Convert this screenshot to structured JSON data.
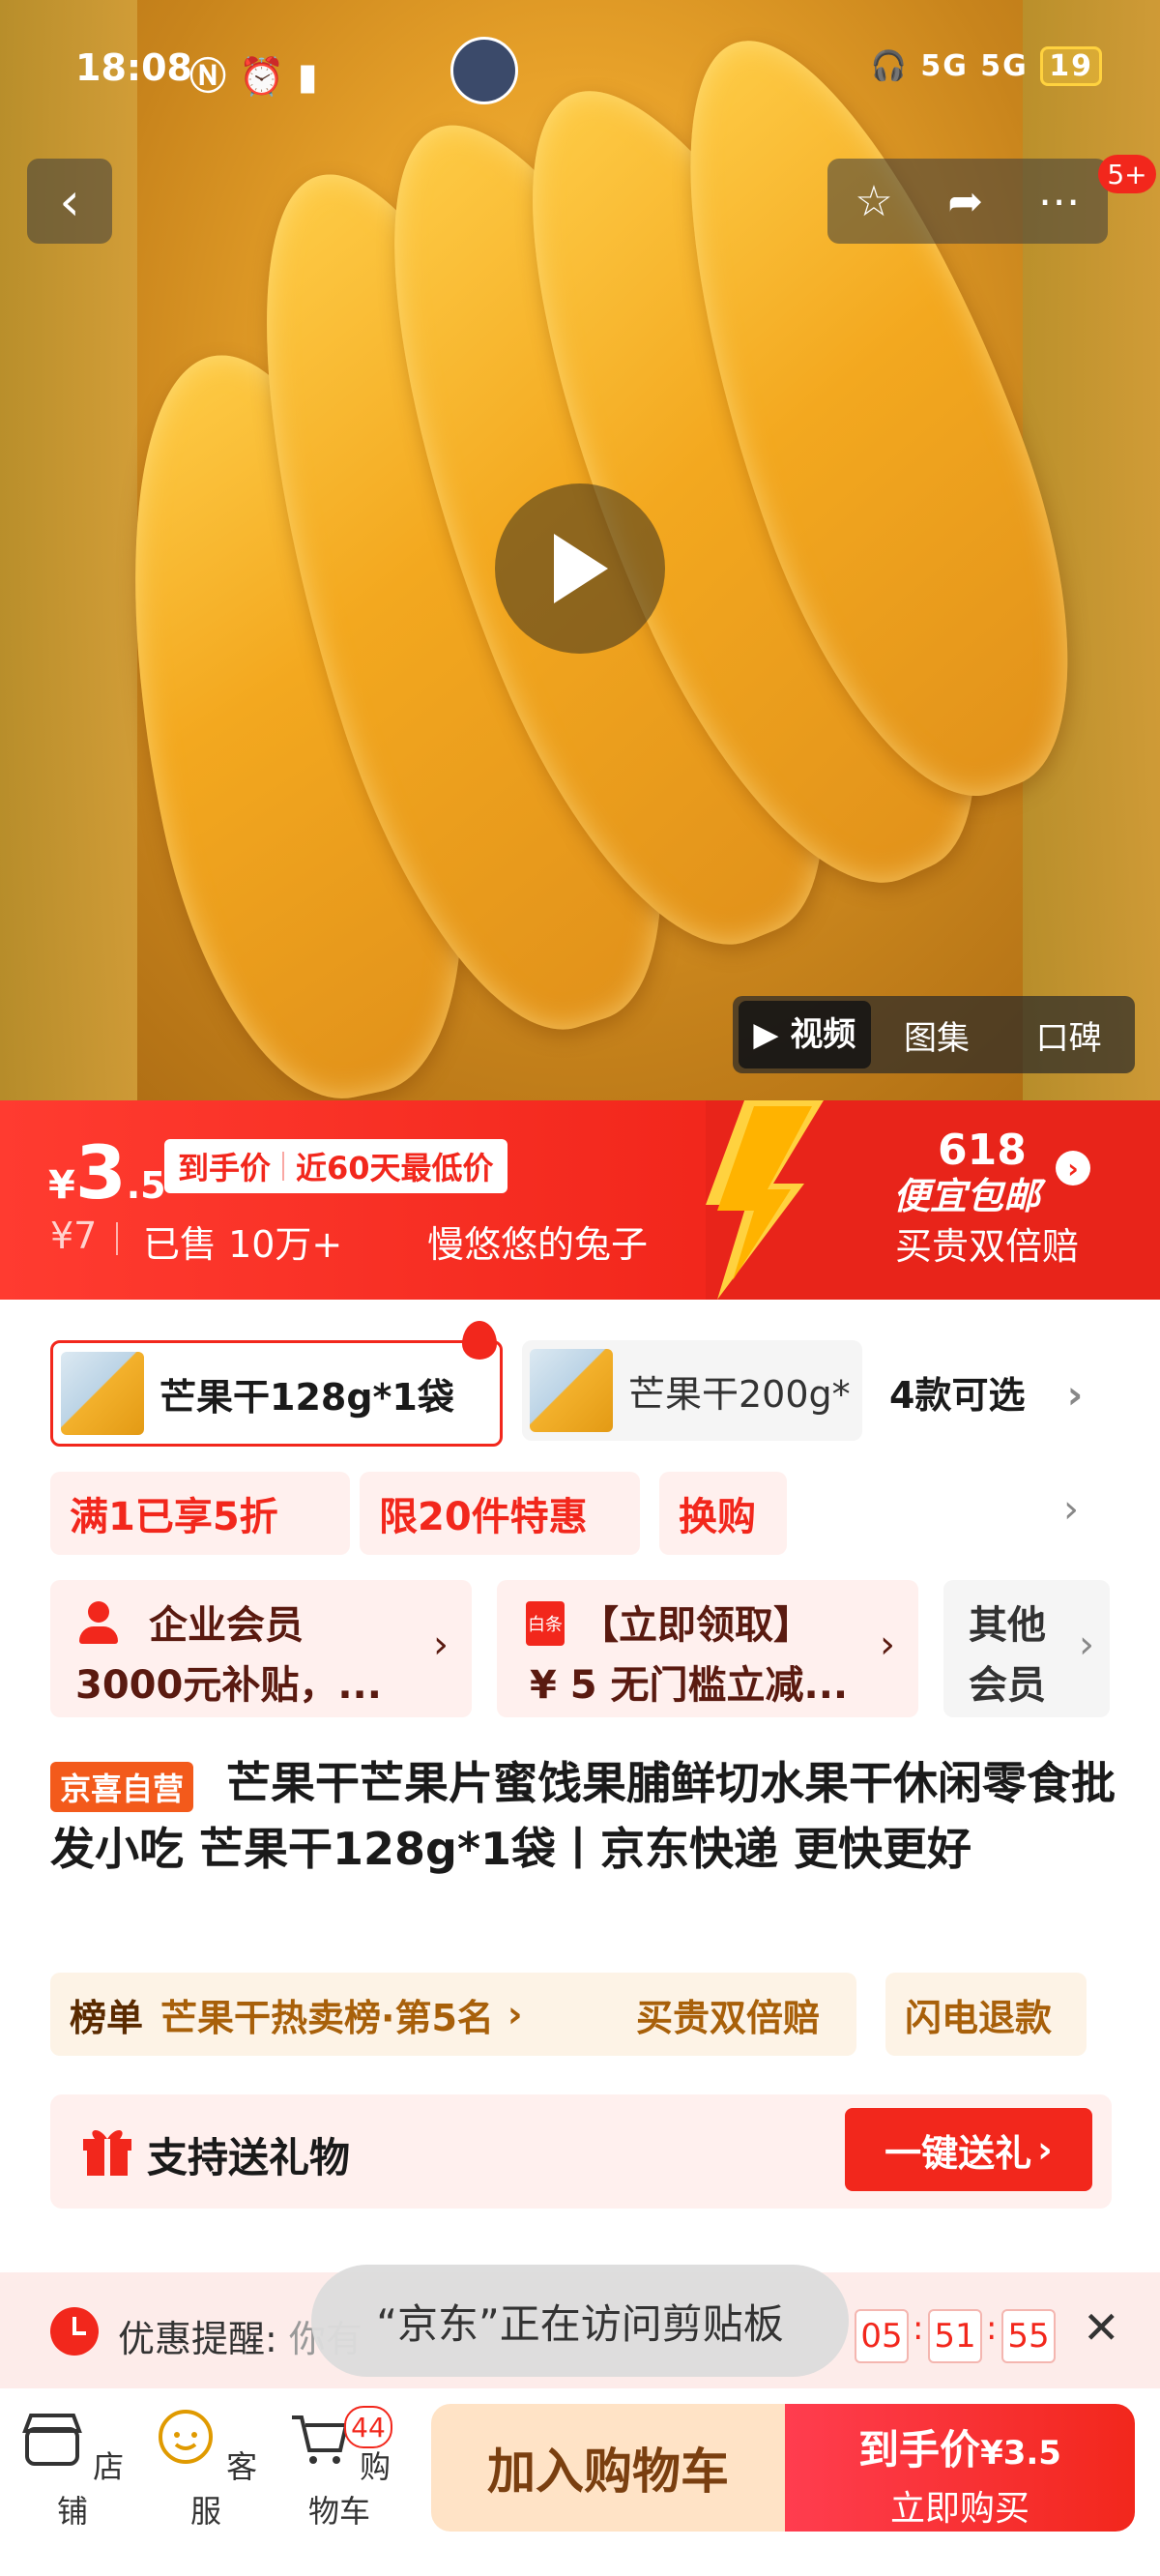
{
  "status_bar": {
    "time": "18:08",
    "right": "5G 5G",
    "battery": "19"
  },
  "top_badge": "5+",
  "media_tabs": [
    "视频",
    "图集",
    "口碑"
  ],
  "price": {
    "yen": "¥",
    "integer": "3",
    "decimal": ".5",
    "tag_label": "到手价",
    "tag_note": "近60天最低价",
    "original": "¥7",
    "sold": "已售 10万+",
    "seller": "慢悠悠的兔子",
    "promo_618": "618",
    "promo_free": "便宜包邮",
    "promo_double": "买贵双倍赔"
  },
  "variants": {
    "selected": "芒果干128g*1袋",
    "other": "芒果干200g*",
    "count": "4款可选"
  },
  "discounts": [
    "满1已享5折",
    "限20件特惠",
    "换购"
  ],
  "member_cards": [
    {
      "title": "企业会员",
      "sub": "3000元补贴，..."
    },
    {
      "badge": "白条",
      "title": "【立即领取】",
      "sub": "¥ 5 无门槛立减..."
    }
  ],
  "other_member": [
    "其他",
    "会员"
  ],
  "product": {
    "self_badge": "京喜自营",
    "title": "芒果干芒果片蜜饯果脯鲜切水果干休闲零食批发小吃 芒果干128g*1袋丨京东快递 更快更好"
  },
  "rank_tags": {
    "rank_label": "榜单",
    "rank_text": "芒果干热卖榜·第5名",
    "t2": "买贵双倍赔",
    "t3": "闪电退款"
  },
  "gift": {
    "label": "支持送礼物",
    "button": "一键送礼"
  },
  "reminder": {
    "label": "优惠提醒:",
    "partial": "你有",
    "h": "05",
    "m": "51",
    "s": "55"
  },
  "toast": "“京东”正在访问剪贴板",
  "bottom_nav": {
    "store": "店铺",
    "service": "客服",
    "cart": "购物车",
    "cart_count": "44",
    "add_cart": "加入购物车",
    "buy_price_label": "到手价",
    "buy_price": "¥3.5",
    "buy_now": "立即购买"
  },
  "colors": {
    "accent": "#f2271c",
    "self_badge": "#f35a1b",
    "add_cart_bg": "#ffe3c6"
  }
}
